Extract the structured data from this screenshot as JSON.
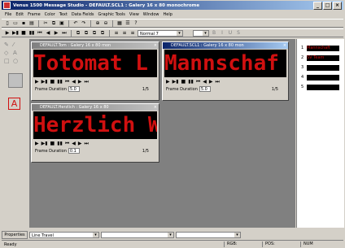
{
  "app": {
    "title": "Venus 1500 Message Studio - DEFAULT.SCL1 : Galery 16 x 80 monochrome"
  },
  "menu": [
    "File",
    "Edit",
    "Frame",
    "Color",
    "Text",
    "Data Fields",
    "Graphic Tools",
    "View",
    "Window",
    "Help"
  ],
  "toolbar": {
    "font_combo": "Normal 7"
  },
  "windows": [
    {
      "title": "DEFAULT.Tom : Galery 16 x 80 mon",
      "led": "Totomat L",
      "duration_label": "Frame Duration",
      "duration": "5.0",
      "page": "1/5"
    },
    {
      "title": "DEFAULT.SCL1 : Galery 16 x 80 mon",
      "led": "Mannschaf",
      "duration_label": "Frame Duration",
      "duration": "5.0",
      "page": "1/5"
    },
    {
      "title": "DEFAULT.Herzlich : Galery 16 x 80",
      "led": "Herzlich W",
      "duration_label": "Frame Duration",
      "duration": "0.1",
      "page": "1/5"
    }
  ],
  "thumbnails": [
    {
      "num": "1",
      "text": "Mannschaft"
    },
    {
      "num": "2",
      "text": "SV Team"
    },
    {
      "num": "3",
      "text": ""
    },
    {
      "num": "4",
      "text": ""
    },
    {
      "num": "5",
      "text": ""
    }
  ],
  "bottom": {
    "properties_label": "Properties",
    "transition": "Line Travel"
  },
  "status": {
    "left": "Ready",
    "rgb": "RGB:",
    "pos": "POS:",
    "num": "NUM"
  },
  "colors": {
    "led": "#d01010",
    "workspace": "#808080",
    "title_active": "#0a246a"
  }
}
